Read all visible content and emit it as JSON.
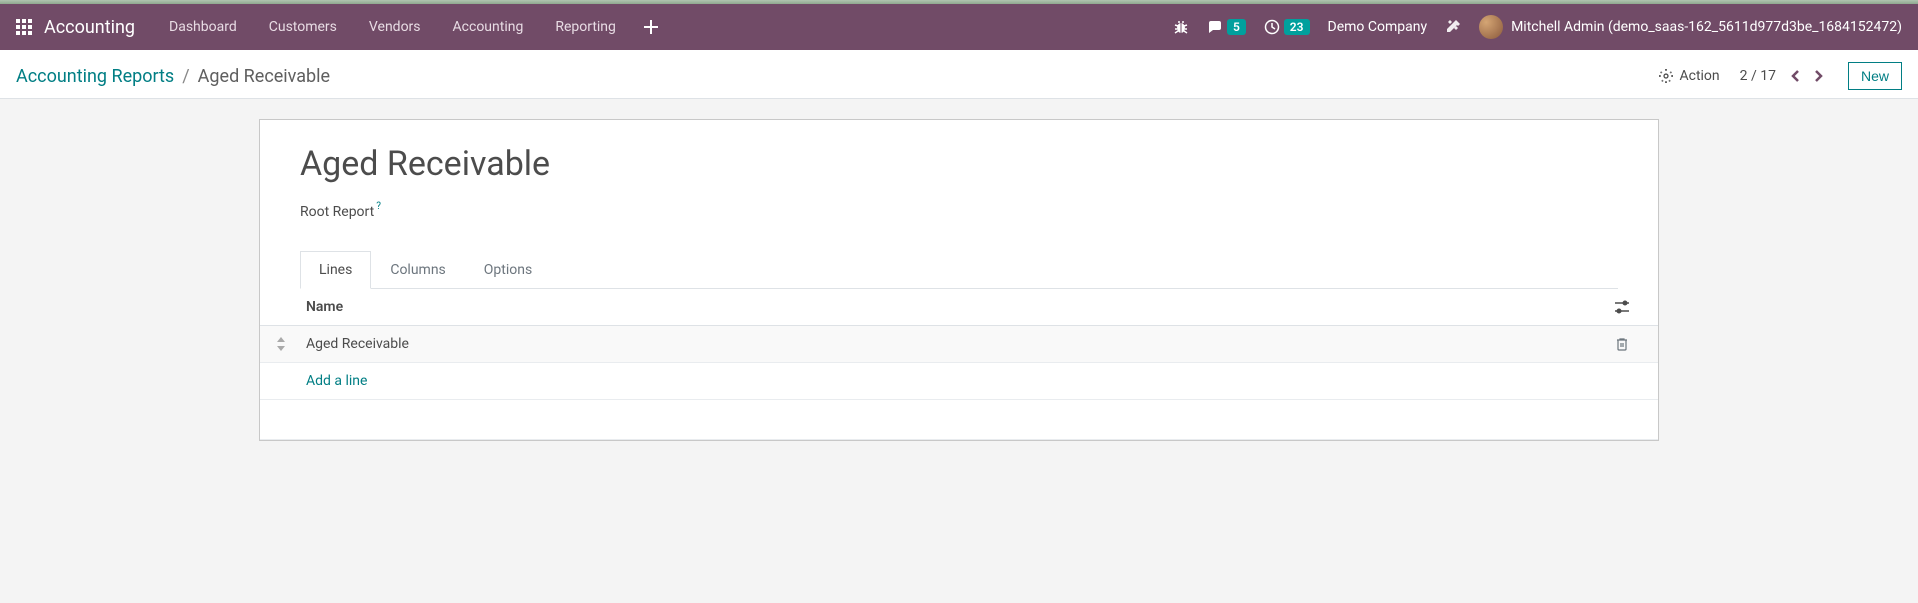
{
  "navbar": {
    "brand": "Accounting",
    "menu": [
      "Dashboard",
      "Customers",
      "Vendors",
      "Accounting",
      "Reporting"
    ],
    "messages_count": "5",
    "activities_count": "23",
    "company": "Demo Company",
    "user": "Mitchell Admin (demo_saas-162_5611d977d3be_1684152472)"
  },
  "breadcrumb": {
    "parent": "Accounting Reports",
    "current": "Aged Receivable"
  },
  "control_panel": {
    "action_label": "Action",
    "pager": "2 / 17",
    "new_label": "New"
  },
  "form": {
    "title": "Aged Receivable",
    "root_report_label": "Root Report",
    "tabs": [
      "Lines",
      "Columns",
      "Options"
    ],
    "column_header": "Name",
    "rows": [
      {
        "name": "Aged Receivable"
      }
    ],
    "add_line_label": "Add a line"
  }
}
